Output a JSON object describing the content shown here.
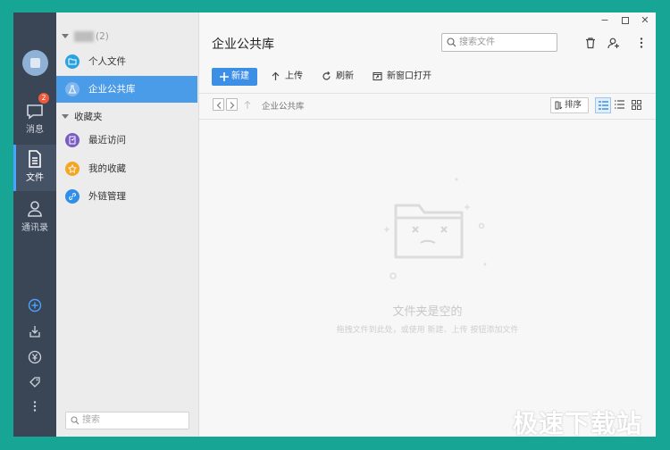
{
  "rail": {
    "items": [
      {
        "label": "消息",
        "badge": "2",
        "icon": "message-icon"
      },
      {
        "label": "文件",
        "icon": "file-icon",
        "active": true
      },
      {
        "label": "通讯录",
        "icon": "contacts-icon"
      }
    ],
    "tools": [
      "add-circle-icon",
      "download-icon",
      "yen-icon",
      "tag-icon",
      "more-vertical-icon"
    ]
  },
  "nav": {
    "group1_count": "(2)",
    "items": [
      {
        "label": "个人文件",
        "icon": "folder-icon",
        "color": "#29a3e0"
      },
      {
        "label": "企业公共库",
        "icon": "flask-icon",
        "active": true
      }
    ],
    "group2_label": "收藏夹",
    "fav_items": [
      {
        "label": "最近访问",
        "icon": "recent-icon",
        "color": "#7a5bc4"
      },
      {
        "label": "我的收藏",
        "icon": "star-icon",
        "color": "#f5a623"
      },
      {
        "label": "外链管理",
        "icon": "link-icon",
        "color": "#2f8fe8"
      }
    ],
    "search_placeholder": "搜索"
  },
  "main": {
    "title": "企业公共库",
    "search_placeholder": "搜索文件",
    "toolbar": {
      "new": "新建",
      "upload": "上传",
      "refresh": "刷新",
      "open_new_window": "新窗口打开"
    },
    "breadcrumb": "企业公共库",
    "sort_label": "排序",
    "empty_title": "文件夹是空的",
    "empty_hint": "拖拽文件到此处，或使用 新建、上传 按钮添加文件"
  },
  "watermark": "极速下载站",
  "colors": {
    "accent": "#3d8fe6",
    "rail_bg": "#3a4556",
    "border_bg": "#17a696"
  }
}
